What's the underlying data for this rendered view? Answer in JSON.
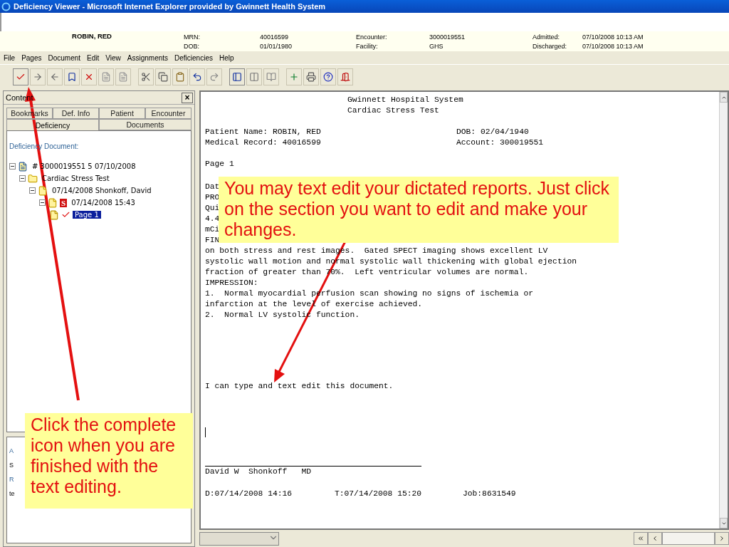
{
  "window": {
    "title": "Deficiency Viewer - Microsoft Internet Explorer provided by Gwinnett Health System"
  },
  "patient": {
    "name": "ROBIN, RED",
    "fields": [
      [
        {
          "label": "MRN:",
          "value": "40016599"
        },
        {
          "label": "DOB:",
          "value": "01/01/1980"
        }
      ],
      [
        {
          "label": "Encounter:",
          "value": "3000019551"
        },
        {
          "label": "Facility:",
          "value": "GHS"
        }
      ],
      [
        {
          "label": "Admitted:",
          "value": "07/10/2008 10:13 AM"
        },
        {
          "label": "Discharged:",
          "value": "07/10/2008 10:13 AM"
        }
      ]
    ]
  },
  "menu": [
    "File",
    "Pages",
    "Document",
    "Edit",
    "View",
    "Assignments",
    "Deficiencies",
    "Help"
  ],
  "panel": {
    "title": "Content",
    "close": "×",
    "tab_rows": [
      [
        {
          "label": "Bookmarks",
          "selected": false
        },
        {
          "label": "Def. Info",
          "selected": false
        },
        {
          "label": "Patient",
          "selected": false
        },
        {
          "label": "Encounter",
          "selected": false
        }
      ],
      [
        {
          "label": "Deficiency",
          "selected": true
        },
        {
          "label": "Documents",
          "selected": false
        }
      ]
    ],
    "section_label": "Deficiency Document:",
    "tree": [
      {
        "kind": "document",
        "label": "# 3000019551  5  07/10/2008",
        "expanded": true,
        "children": [
          {
            "kind": "folder",
            "label": "Cardiac Stress Test",
            "expanded": true,
            "children": [
              {
                "kind": "file",
                "label": "07/14/2008 Shonkoff, David",
                "expanded": true,
                "children": [
                  {
                    "kind": "file",
                    "badge": "S",
                    "label": "07/14/2008 15:43",
                    "expanded": true,
                    "children": [
                      {
                        "kind": "page",
                        "label": "Page 1",
                        "checked": true,
                        "selected": true
                      }
                    ]
                  }
                ]
              }
            ]
          }
        ]
      }
    ],
    "lower": [
      {
        "kind": "label",
        "text": "A"
      },
      {
        "kind": "value",
        "text": "S"
      },
      {
        "kind": "label",
        "text": "R"
      },
      {
        "kind": "value",
        "text": "te"
      }
    ]
  },
  "document": {
    "heading": [
      "Gwinnett Hospital System",
      "Cardiac Stress Test"
    ],
    "fields": [
      {
        "left": "Patient Name: ROBIN, RED",
        "right": "DOB: 02/04/1940"
      },
      {
        "left": "Medical Record: 40016599",
        "right": "Account: 300019551"
      }
    ],
    "page_label": "Page 1",
    "body": [
      "Dat",
      "PRO",
      "Qui",
      "4.4",
      "mCi",
      "FIN",
      "on both stress and rest images.  Gated SPECT imaging shows excellent LV",
      "systolic wall motion and normal systolic wall thickening with global ejection",
      "fraction of greater than 70%.  Left ventricular volumes are normal.",
      "IMPRESSION:",
      "1.  Normal myocardial perfusion scan showing no signs of ischemia or",
      "infarction at the level of exercise achieved.",
      "2.  Normal LV systolic function."
    ],
    "typed_note": "I can type and text edit this document.",
    "signature": "David W  Shonkoff   MD",
    "footer": [
      "D:07/14/2008 14:16",
      "T:07/14/2008 15:20",
      "Job:8631549"
    ]
  },
  "callouts": [
    {
      "text": "You may text edit your dictated reports. Just click on the section you want to edit and make your changes."
    },
    {
      "text": "Click the complete icon when you are finished with the text editing."
    }
  ]
}
